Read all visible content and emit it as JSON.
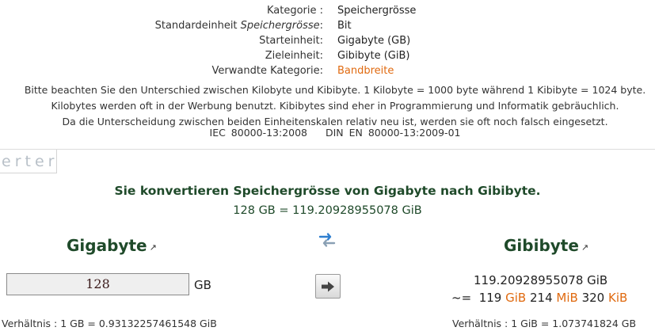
{
  "info": {
    "category_key": "Kategorie :",
    "category_val": "Speichergrösse",
    "std_unit_key_prefix": "Standardeinheit ",
    "std_unit_key_italic": "Speichergrösse",
    "std_unit_key_suffix": ":",
    "std_unit_val": "Bit",
    "start_unit_key": "Starteinheit:",
    "start_unit_val": "Gigabyte (GB)",
    "target_unit_key": "Zieleinheit:",
    "target_unit_val": "Gibibyte (GiB)",
    "related_key": "Verwandte Kategorie:",
    "related_val": "Bandbreite"
  },
  "note": {
    "line1": "Bitte beachten Sie den Unterschied zwischen Kilobyte und Kibibyte. 1 Kilobyte = 1000 byte während 1 Kibibyte = 1024 byte.",
    "line2": "Kilobytes werden oft in der Werbung benutzt. Kibibytes sind eher in Programmierung und Informatik gebräuchlich.",
    "line3": "Da die Unterscheidung zwischen beiden Einheitenskalen relativ neu ist, werden sie oft noch falsch eingesetzt.",
    "std1": "IEC 80000-13:2008",
    "std2": "DIN EN 80000-13:2009-01"
  },
  "tab_fragment": "erter",
  "converter": {
    "headline": "Sie konvertieren Speichergrösse von Gigabyte nach Gibibyte.",
    "result_line": "128 GB = 119.20928955078 GiB",
    "from_title": "Gigabyte",
    "to_title": "Gibibyte",
    "ext_icon": "external-link-icon",
    "input_value": "128",
    "input_unit": "GB",
    "output_value": "119.20928955078 GiB",
    "approx_prefix": "~=",
    "gib_num": "119",
    "gib_unit": "GiB",
    "mib_num": "214",
    "mib_unit": "MiB",
    "kib_num": "320",
    "kib_unit": "KiB",
    "ratio_left": "Verhältnis : 1 GB = 0.93132257461548 GiB",
    "ratio_right": "Verhältnis : 1 GiB = 1.073741824 GB"
  },
  "colors": {
    "heading_green": "#1f4a2a",
    "accent_orange": "#e06a10",
    "swap_blue": "#2f7fd0"
  }
}
